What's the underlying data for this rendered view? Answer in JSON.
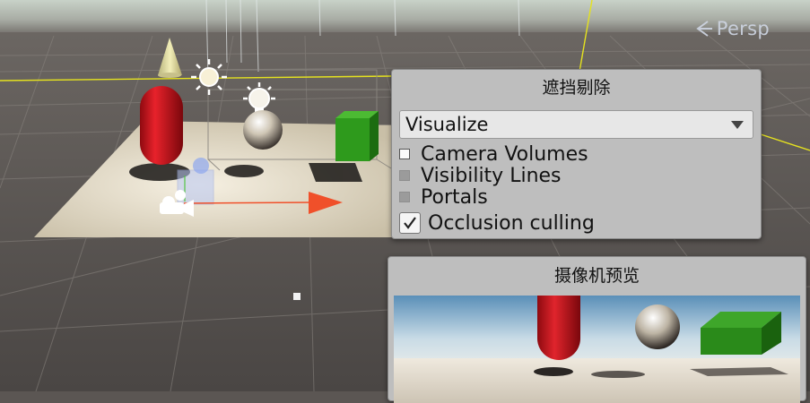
{
  "scene_view": {
    "camera_mode_label": "Persp",
    "camera_mode_icon": "back-arrow-icon"
  },
  "occlusion_panel": {
    "title": "遮挡剔除",
    "mode_dropdown": {
      "selected": "Visualize"
    },
    "options": [
      {
        "label": "Camera Volumes",
        "checked": false,
        "enabled": true
      },
      {
        "label": "Visibility Lines",
        "checked": false,
        "enabled": false
      },
      {
        "label": "Portals",
        "checked": false,
        "enabled": false
      },
      {
        "label": "Occlusion culling",
        "checked": true,
        "enabled": true
      }
    ]
  },
  "camera_preview_panel": {
    "title": "摄像机预览"
  },
  "colors": {
    "panel_bg": "#bebebe",
    "capsule_red": "#c8101a",
    "cube_green": "#2e9a1c",
    "gizmo_yellow": "#e5e21f",
    "axis_red": "#f0502a"
  }
}
